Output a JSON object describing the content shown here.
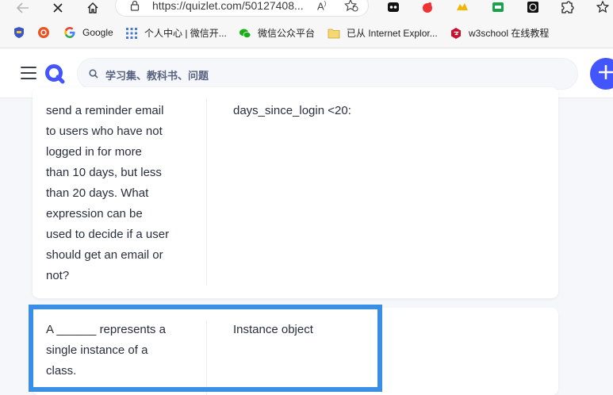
{
  "browser": {
    "url": "https://quizlet.com/50127408...",
    "bookmarks": [
      {
        "label": "Google",
        "icon": "google-icon"
      },
      {
        "label": "个人中心 | 微信开...",
        "icon": "apps-grid-icon"
      },
      {
        "label": "微信公众平台",
        "icon": "wechat-icon"
      },
      {
        "label": "已从 Internet Explor...",
        "icon": "folder-icon"
      },
      {
        "label": "w3school 在线教程",
        "icon": "w3school-icon"
      }
    ]
  },
  "header": {
    "search_placeholder": "学习集、教科书、问题"
  },
  "cards": [
    {
      "term_lines": [
        "send a reminder email",
        "to users who have not",
        "logged in for more",
        "than 10 days, but less",
        "than 20 days. What",
        "expression can be",
        "used to decide if a user",
        "should get an email or",
        "not?"
      ],
      "definition": "days_since_login <20:"
    },
    {
      "term_lines": [
        "A ______ represents a",
        "single instance of a",
        "class."
      ],
      "definition": "Instance object"
    }
  ],
  "colors": {
    "brand": "#4255ff",
    "highlight": "#3a8ee6"
  }
}
